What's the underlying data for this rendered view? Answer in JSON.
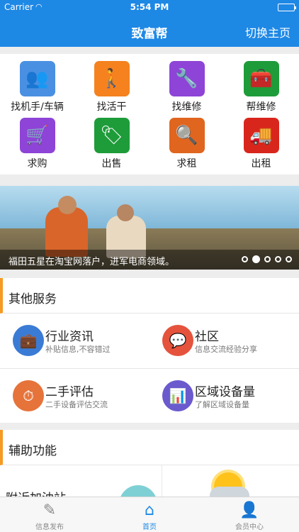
{
  "status_bar": {
    "carrier": "Carrier",
    "time": "5:54 PM",
    "wifi_icon": "wifi-icon",
    "battery_level": 1.0
  },
  "nav": {
    "title": "致富帮",
    "right_label": "切换主页"
  },
  "grid": {
    "items": [
      {
        "label": "找机手/车辆",
        "icon": "people-icon",
        "color": "#4a90e2",
        "glyph": "👥"
      },
      {
        "label": "找活干",
        "icon": "walking-icon",
        "color": "#f5821f",
        "glyph": "🚶"
      },
      {
        "label": "找维修",
        "icon": "wrench-icon",
        "color": "#8e44d6",
        "glyph": "🔧"
      },
      {
        "label": "帮维修",
        "icon": "toolbox-icon",
        "color": "#1e9c3a",
        "glyph": "🧰"
      },
      {
        "label": "求购",
        "icon": "cart-icon",
        "color": "#8e44d6",
        "glyph": "🛒"
      },
      {
        "label": "出售",
        "icon": "price-tag-icon",
        "color": "#1e9c3a",
        "glyph": "🏷"
      },
      {
        "label": "求租",
        "icon": "search-icon",
        "color": "#e0651f",
        "glyph": "🔍"
      },
      {
        "label": "出租",
        "icon": "truck-icon",
        "color": "#d9261c",
        "glyph": "🚚"
      }
    ]
  },
  "banner": {
    "caption": "福田五星在淘宝网落户，进军电商领域。",
    "page_count": 5,
    "active_index": 1
  },
  "other_services": {
    "heading": "其他服务",
    "items": [
      {
        "title": "行业资讯",
        "subtitle": "补贴信息,不容错过",
        "icon": "briefcase-icon",
        "color": "#3a7bd5",
        "glyph": "💼"
      },
      {
        "title": "社区",
        "subtitle": "信息交流经验分享",
        "icon": "chat-bubbles-icon",
        "color": "#e5533d",
        "glyph": "💬"
      },
      {
        "title": "二手评估",
        "subtitle": "二手设备评估交流",
        "icon": "appraisal-icon",
        "color": "#e6733a",
        "glyph": "⏱"
      },
      {
        "title": "区域设备量",
        "subtitle": "了解区域设备量",
        "icon": "analytics-icon",
        "color": "#6a5acd",
        "glyph": "📊"
      }
    ]
  },
  "aux": {
    "heading": "辅助功能",
    "first_item_text": "附近加油站"
  },
  "tabbar": {
    "tabs": [
      {
        "label": "信息发布",
        "icon": "edit-icon",
        "glyph": "✎"
      },
      {
        "label": "首页",
        "icon": "home-icon",
        "glyph": "⌂"
      },
      {
        "label": "会员中心",
        "icon": "user-icon",
        "glyph": "👤"
      }
    ],
    "active_index": 1
  }
}
